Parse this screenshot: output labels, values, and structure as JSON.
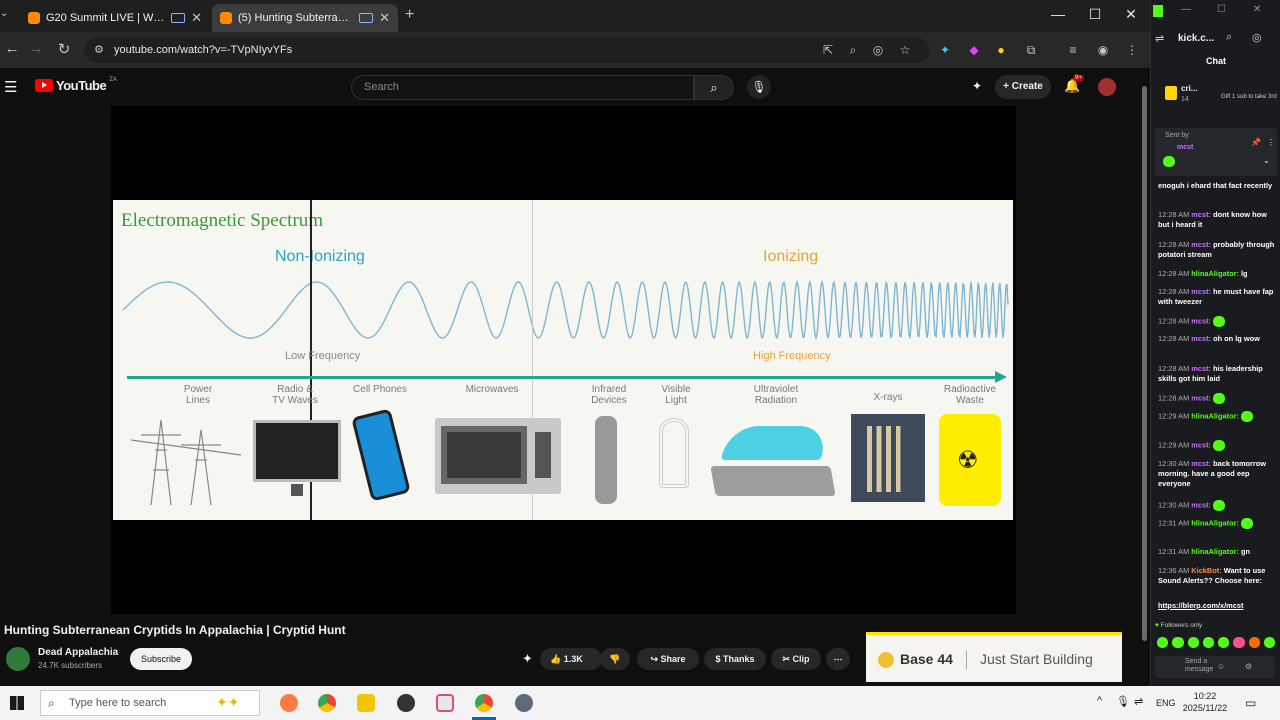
{
  "browser": {
    "tabs": [
      {
        "title": "G20 Summit LIVE | World Le",
        "active": false
      },
      {
        "title": "(5) Hunting Subterranean C",
        "active": true
      }
    ],
    "url": "youtube.com/watch?v=-TVpNIyvYFs",
    "side_tab_title": "kick.c..."
  },
  "youtube": {
    "logo_text": "YouTube",
    "logo_sup": "ZA",
    "search_placeholder": "Search",
    "create_label": "Create",
    "notification_count": "9+"
  },
  "slide": {
    "title": "Electromagnetic Spectrum",
    "non_ionizing": "Non-Ionizing",
    "ionizing": "Ionizing",
    "low_frequency": "Low Frequency",
    "high_frequency": "High Frequency",
    "categories": [
      {
        "line1": "Power",
        "line2": "Lines"
      },
      {
        "line1": "Radio &",
        "line2": "TV Waves"
      },
      {
        "line1": "Cell Phones",
        "line2": ""
      },
      {
        "line1": "Microwaves",
        "line2": ""
      },
      {
        "line1": "Infrared",
        "line2": "Devices"
      },
      {
        "line1": "Visible",
        "line2": "Light"
      },
      {
        "line1": "Ultraviolet",
        "line2": "Radiation"
      },
      {
        "line1": "X-rays",
        "line2": ""
      },
      {
        "line1": "Radioactive",
        "line2": "Waste"
      }
    ]
  },
  "video": {
    "title": "Hunting Subterranean Cryptids In Appalachia | Cryptid Hunt",
    "channel": "Dead Appalachia",
    "subscribers": "24.7K subscribers",
    "subscribe_label": "Subscribe",
    "likes": "1.3K",
    "share_label": "Share",
    "thanks_label": "Thanks",
    "clip_label": "Clip"
  },
  "ad": {
    "brand": "Base 44",
    "slogan": "Just Start Building"
  },
  "chat": {
    "header": "Chat",
    "top_user": "cri...",
    "top_count": "14",
    "gift_note": "Gift 1 sub to take 3rd",
    "pinned_label": "Sent by",
    "pinned_user": "mcst",
    "messages": [
      {
        "ts": "",
        "user": "",
        "text": "enoguh i ehard that fact recently"
      },
      {
        "ts": "12:28 AM",
        "user": "mcst:",
        "text": "dont know how but i heard it"
      },
      {
        "ts": "12:28 AM",
        "user": "mcst:",
        "text": "probably through potatori stream"
      },
      {
        "ts": "12:28 AM",
        "user": "hlinaAligator:",
        "text": "lg"
      },
      {
        "ts": "12:28 AM",
        "user": "mcst:",
        "text": "he must have fap with tweezer"
      },
      {
        "ts": "12:28 AM",
        "user": "mcst:",
        "text": ""
      },
      {
        "ts": "12:28 AM",
        "user": "mcst:",
        "text": "oh on lg wow"
      },
      {
        "ts": "12:28 AM",
        "user": "mcst:",
        "text": "his leadership skills got him laid"
      },
      {
        "ts": "12:28 AM",
        "user": "mcst:",
        "text": ""
      },
      {
        "ts": "12:29 AM",
        "user": "hlinaAligator:",
        "text": ""
      },
      {
        "ts": "12:29 AM",
        "user": "mcst:",
        "text": ""
      },
      {
        "ts": "12:30 AM",
        "user": "mcst:",
        "text": "back tomorrow morning. have a good eep everyone"
      },
      {
        "ts": "12:30 AM",
        "user": "mcst:",
        "text": ""
      },
      {
        "ts": "12:31 AM",
        "user": "hlinaAligator:",
        "text": ""
      },
      {
        "ts": "12:31 AM",
        "user": "hlinaAligator:",
        "text": "gn"
      },
      {
        "ts": "12:36 AM",
        "user": "KickBot:",
        "text": "Want to use Sound Alerts?? Choose here:"
      },
      {
        "ts": "",
        "user": "",
        "text": "https://blerp.com/x/mcst"
      }
    ],
    "followers_only": "Followers only",
    "send_placeholder": "Send a message"
  },
  "taskbar": {
    "search_placeholder": "Type here to search",
    "lang": "ENG",
    "time": "10:22",
    "date": "2025/11/22"
  }
}
